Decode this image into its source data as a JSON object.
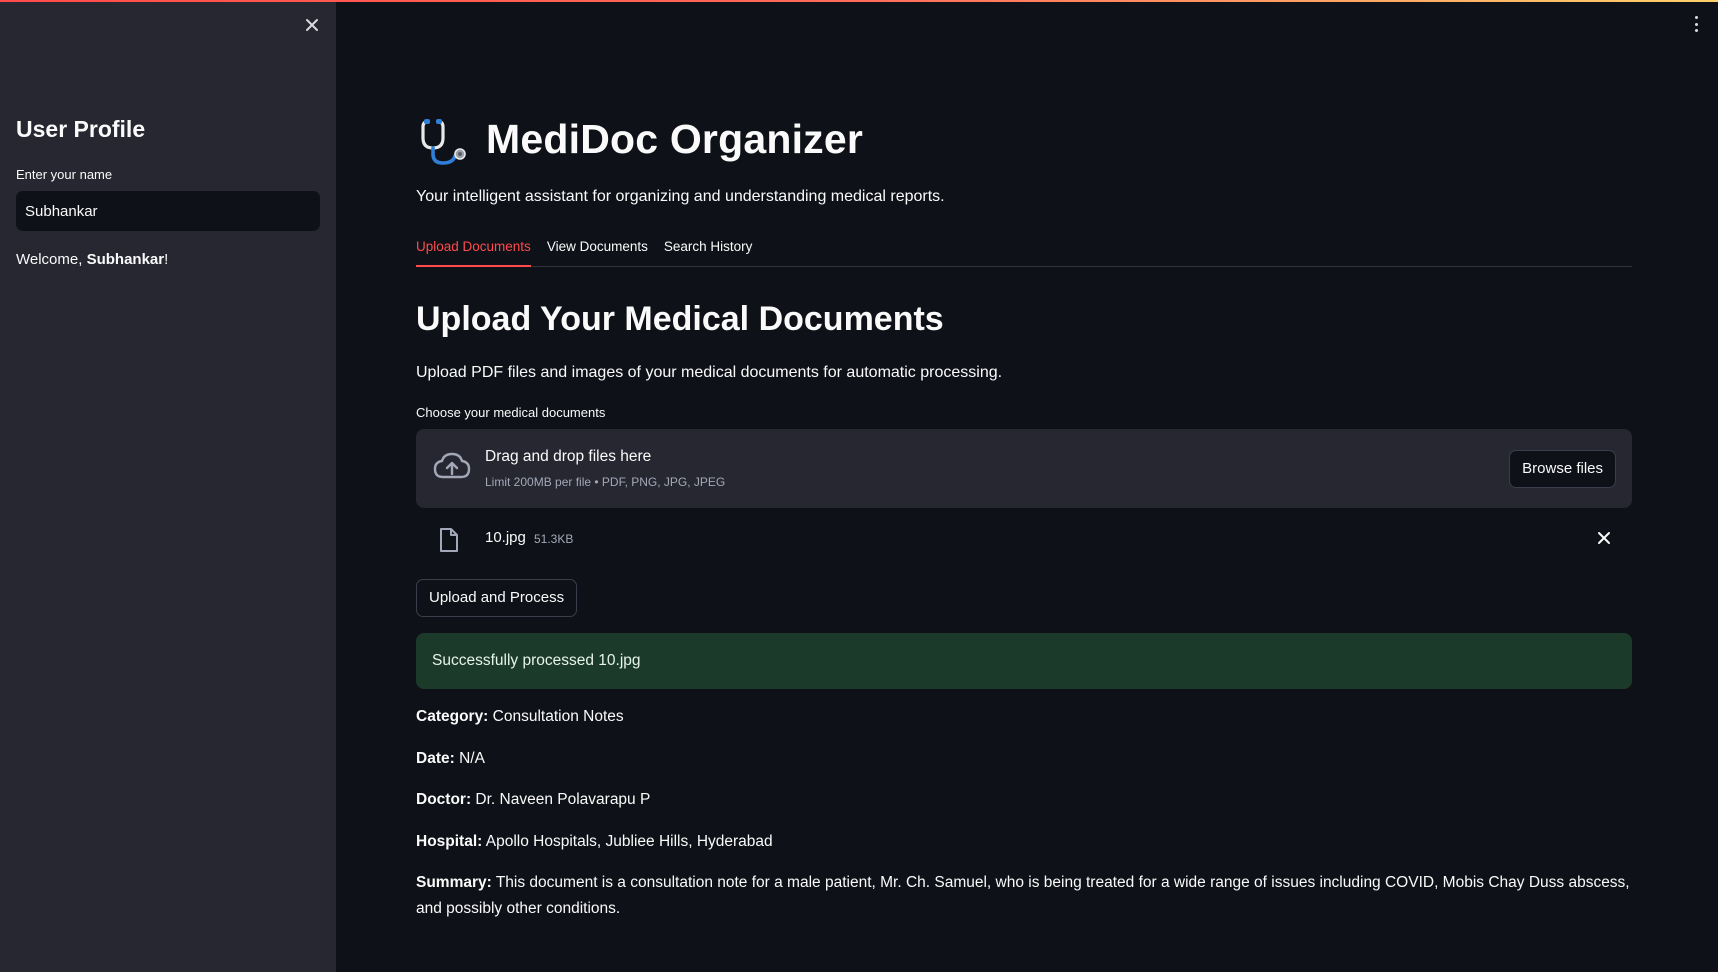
{
  "sidebar": {
    "title": "User Profile",
    "name_label": "Enter your name",
    "name_value": "Subhankar",
    "welcome_prefix": "Welcome, ",
    "welcome_name": "Subhankar",
    "welcome_suffix": "!"
  },
  "app": {
    "title": "MediDoc Organizer",
    "tagline": "Your intelligent assistant for organizing and understanding medical reports."
  },
  "tabs": [
    {
      "label": "Upload Documents",
      "active": true
    },
    {
      "label": "View Documents",
      "active": false
    },
    {
      "label": "Search History",
      "active": false
    }
  ],
  "upload": {
    "title": "Upload Your Medical Documents",
    "description": "Upload PDF files and images of your medical documents for automatic processing.",
    "uploader_label": "Choose your medical documents",
    "drop_title": "Drag and drop files here",
    "drop_limit": "Limit 200MB per file • PDF, PNG, JPG, JPEG",
    "browse_label": "Browse files",
    "file_name": "10.jpg",
    "file_size": "51.3KB",
    "process_label": "Upload and Process",
    "success_message": "Successfully processed 10.jpg"
  },
  "result": {
    "category_label": "Category:",
    "category_value": " Consultation Notes",
    "date_label": "Date:",
    "date_value": " N/A",
    "doctor_label": "Doctor:",
    "doctor_value": " Dr. Naveen Polavarapu P",
    "hospital_label": "Hospital:",
    "hospital_value": " Apollo Hospitals, Jubliee Hills, Hyderabad",
    "summary_label": "Summary:",
    "summary_value": " This document is a consultation note for a male patient, Mr. Ch. Samuel, who is being treated for a wide range of issues including COVID, Mobis Chay Duss abscess, and possibly other conditions."
  },
  "colors": {
    "accent": "#ff4b4b",
    "background": "#0e1117",
    "sidebar": "#262730",
    "success_bg": "#1b3a2a"
  }
}
